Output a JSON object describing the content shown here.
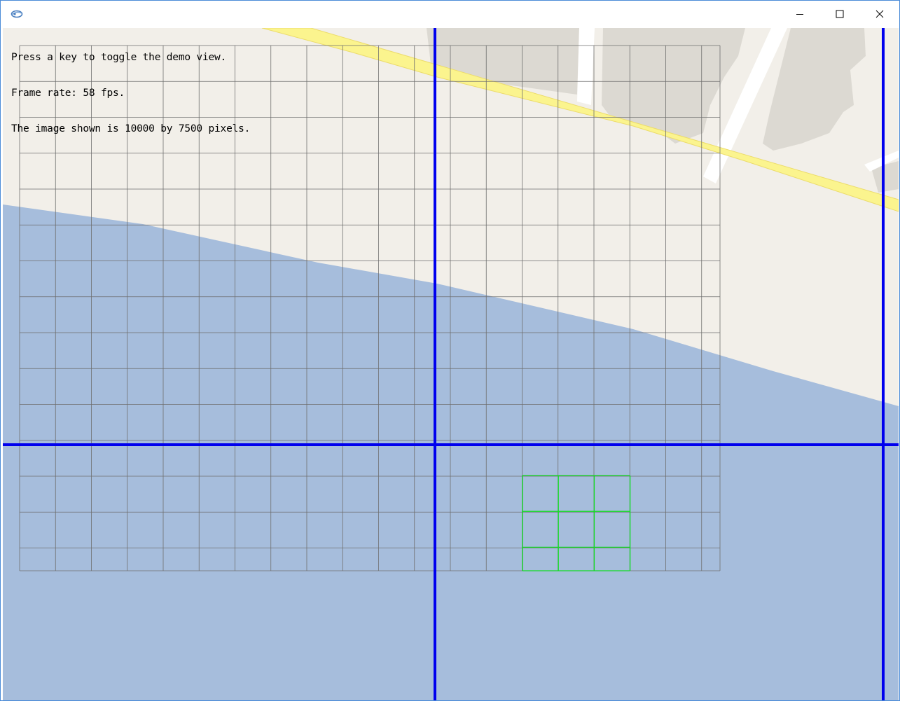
{
  "window": {
    "app_icon": "app-logo-icon",
    "controls": {
      "minimize_icon": "minimize-icon",
      "maximize_icon": "maximize-icon",
      "close_icon": "close-icon"
    }
  },
  "overlay": {
    "line1": "Press a key to toggle the demo view.",
    "line2": "Frame rate: 58 fps.",
    "line3": "The image shown is 10000 by 7500 pixels."
  },
  "colors": {
    "land": "#f2efe9",
    "water": "#a6bddc",
    "road_yellow": "#fbf48e",
    "road_border": "#f3e27a",
    "building": "#dcd9d2",
    "street_white": "#ffffff",
    "grid_gray": "#6e6e6e",
    "viewport_lines": "#0000ee",
    "highlight_grid": "#11dd22"
  }
}
